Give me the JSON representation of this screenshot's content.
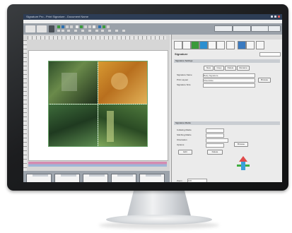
{
  "window": {
    "title": "Signature Pro - Print Signature - Document Name"
  },
  "toolbar": {
    "buttons": [
      "",
      "",
      "",
      ""
    ]
  },
  "panel": {
    "title": "Signature",
    "dropdown_value": "",
    "sections": [
      "Signature Settings",
      "Signature Marks"
    ],
    "tabs": [
      "New",
      "Copy",
      "Delete",
      "Rename"
    ],
    "fields": [
      {
        "label": "Signature Name",
        "value": "Body Signature"
      },
      {
        "label": "Print Layout",
        "value": "Sheetwise"
      },
      {
        "label": "Signature Size",
        "value": ""
      }
    ],
    "marks_fields": [
      {
        "label": "Collating Marks",
        "value": ""
      },
      {
        "label": "Stitching Marks",
        "value": ""
      },
      {
        "label": "Orientation",
        "value": ""
      },
      {
        "label": "Options",
        "value": ""
      }
    ],
    "buttons": [
      "Edit",
      "Delete",
      "Browse"
    ],
    "zoom_label": "Zoom",
    "zoom_value": "100"
  },
  "thumbnails": {
    "count": 5
  },
  "colors": {
    "accent": "#2d3d55",
    "photo_green": "#3d6b3a",
    "photo_orange": "#d08a2a"
  }
}
